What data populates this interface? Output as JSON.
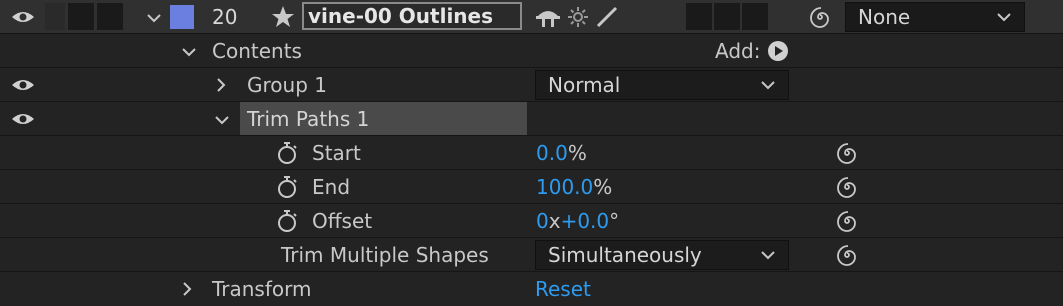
{
  "layer": {
    "number": "20",
    "name": "vine-00 Outlines",
    "label_color": "#6b7fe0",
    "parent": "None"
  },
  "contents": {
    "label": "Contents",
    "add_label": "Add:"
  },
  "group1": {
    "label": "Group 1",
    "blend_mode": "Normal"
  },
  "trim": {
    "label": "Trim Paths 1",
    "start_label": "Start",
    "start_value": "0.0",
    "start_unit": "%",
    "end_label": "End",
    "end_value": "100.0",
    "end_unit": "%",
    "offset_label": "Offset",
    "offset_rev": "0",
    "offset_x": "x",
    "offset_deg": "+0.0",
    "offset_unit": "°",
    "multiple_label": "Trim Multiple Shapes",
    "multiple_value": "Simultaneously"
  },
  "transform": {
    "label": "Transform",
    "reset_label": "Reset"
  },
  "colors": {
    "background": "#232323",
    "header_row": "#303030",
    "value_blue": "#2d9bf0",
    "selected_row": "#4a4a4a"
  }
}
